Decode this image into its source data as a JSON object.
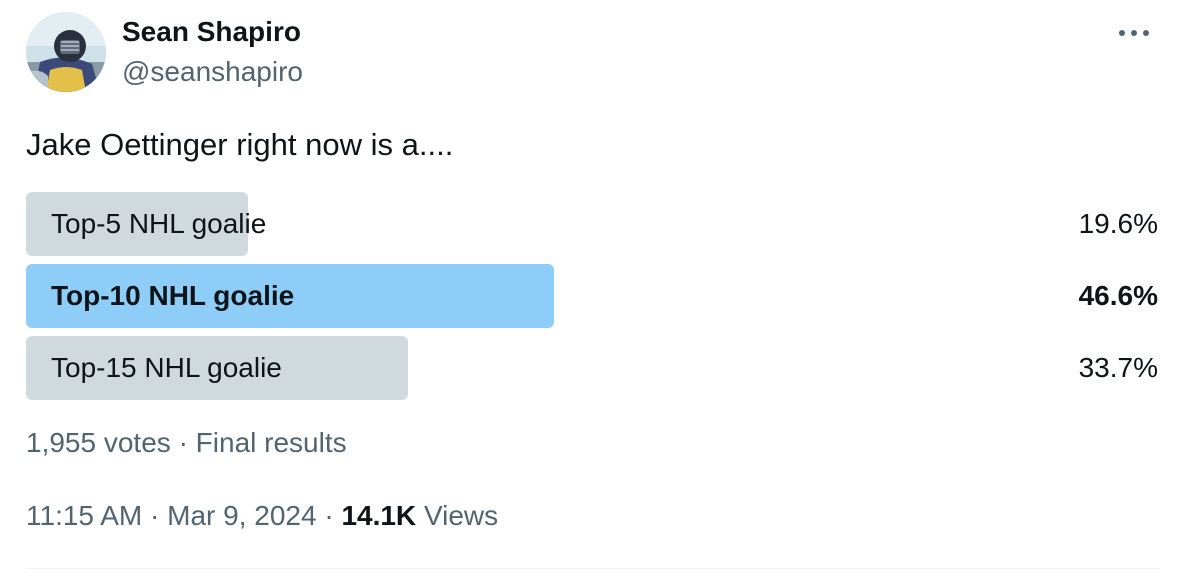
{
  "author": {
    "name": "Sean Shapiro",
    "handle": "@seanshapiro"
  },
  "tweet": {
    "text": "Jake Oettinger right now is a...."
  },
  "poll": {
    "options": [
      {
        "label": "Top-5 NHL goalie",
        "percent_text": "19.6%",
        "percent": 19.6,
        "winner": false
      },
      {
        "label": "Top-10 NHL goalie",
        "percent_text": "46.6%",
        "percent": 46.6,
        "winner": true
      },
      {
        "label": "Top-15 NHL goalie",
        "percent_text": "33.7%",
        "percent": 33.7,
        "winner": false
      }
    ],
    "votes": "1,955 votes",
    "separator": "·",
    "status": "Final results"
  },
  "meta": {
    "time": "11:15 AM",
    "separator": "·",
    "date": "Mar 9, 2024",
    "views_count": "14.1K",
    "views_label": "Views"
  },
  "icons": {
    "more": "more-horizontal-icon"
  },
  "colors": {
    "poll_bar": "#cfd9de",
    "poll_bar_winner": "#8ecdf8",
    "secondary_text": "#536471",
    "primary_text": "#0f1419"
  }
}
